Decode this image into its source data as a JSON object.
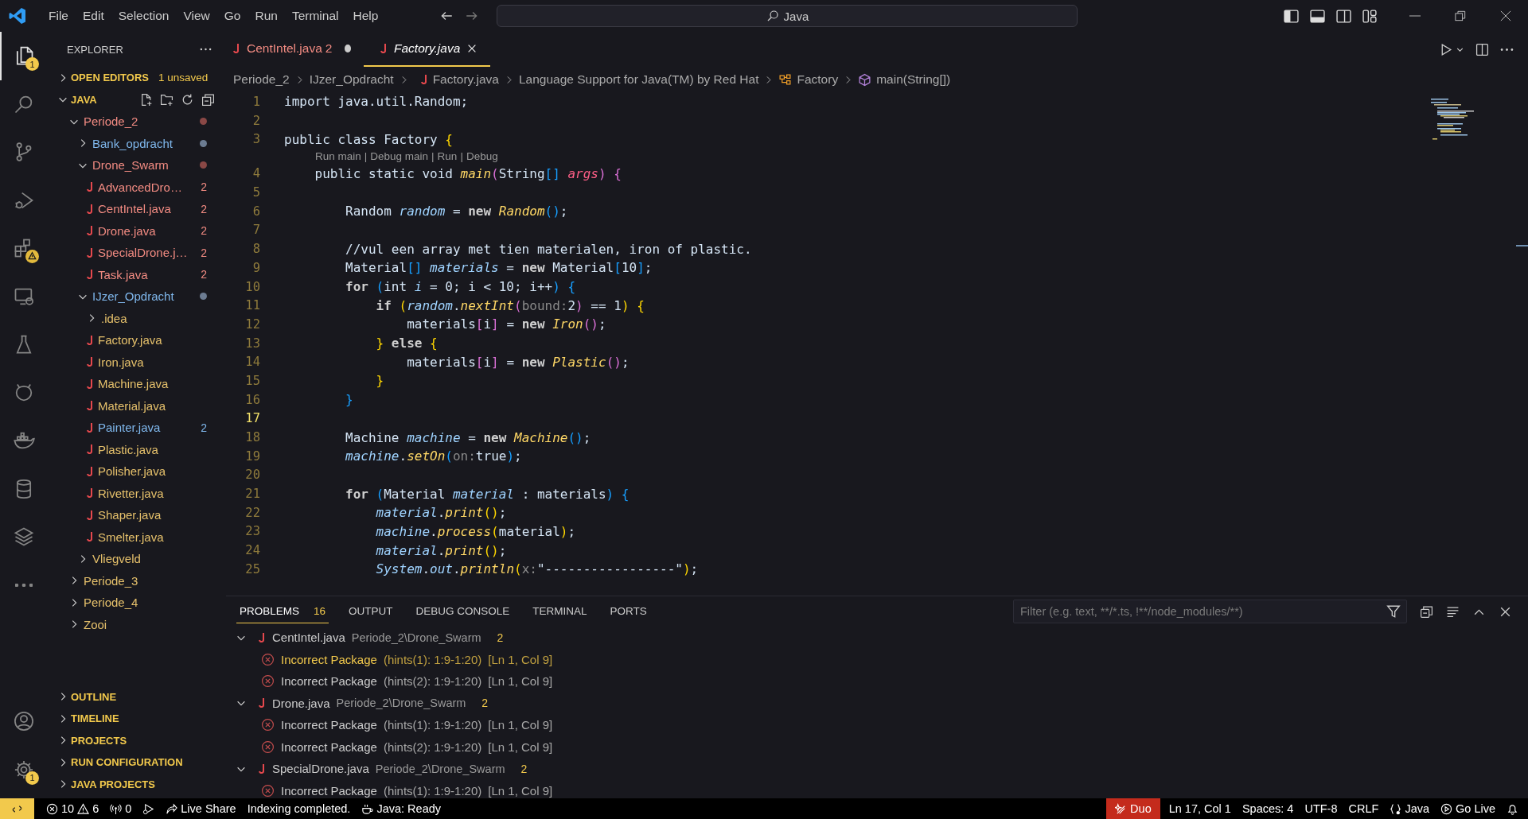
{
  "menu": [
    "File",
    "Edit",
    "Selection",
    "View",
    "Go",
    "Run",
    "Terminal",
    "Help"
  ],
  "command_center": {
    "text": "Java"
  },
  "activity_bar": {
    "top": [
      {
        "kind": "explorer",
        "selected": true,
        "badge": "1",
        "warning": false
      },
      {
        "kind": "search",
        "selected": false,
        "warning": false
      },
      {
        "kind": "scm",
        "selected": false,
        "warning": false
      },
      {
        "kind": "debug",
        "selected": false,
        "warning": false
      },
      {
        "kind": "extensions",
        "selected": false,
        "warning": true
      },
      {
        "kind": "remote",
        "selected": false,
        "warning": false
      },
      {
        "kind": "testing",
        "selected": false,
        "warning": false
      },
      {
        "kind": "alien",
        "selected": false,
        "warning": false
      },
      {
        "kind": "docker",
        "selected": false,
        "warning": false
      },
      {
        "kind": "database",
        "selected": false,
        "warning": false
      },
      {
        "kind": "layers",
        "selected": false,
        "warning": false
      },
      {
        "kind": "more",
        "selected": false,
        "warning": false
      }
    ],
    "bottom": [
      {
        "kind": "account",
        "selected": false,
        "warning": false
      },
      {
        "kind": "settings",
        "selected": false,
        "badge": "1",
        "warning": false
      }
    ]
  },
  "sidebar": {
    "title": "EXPLORER",
    "open_editors": {
      "title": "OPEN EDITORS",
      "expanded": false,
      "note": "1 unsaved"
    },
    "workspace": {
      "title": "JAVA",
      "expanded": true,
      "tree": [
        {
          "name": "Periode_2",
          "kind": "folder",
          "color": "#f28b82",
          "dot": {
            "color": "#8a4846"
          },
          "expanded": true,
          "children": [
            {
              "name": "Bank_opdracht",
              "kind": "folder",
              "color": "#7fb7ec",
              "dot": {
                "color": "#6c7c92"
              },
              "expanded": false
            },
            {
              "name": "Drone_Swarm",
              "kind": "folder",
              "color": "#f28b82",
              "dot": {
                "color": "#8a4846"
              },
              "expanded": true,
              "children": [
                {
                  "name": "AdvancedDro…",
                  "kind": "file",
                  "color": "#f28b82",
                  "badge": "2"
                },
                {
                  "name": "CentIntel.java",
                  "kind": "file",
                  "color": "#f28b82",
                  "badge": "2"
                },
                {
                  "name": "Drone.java",
                  "kind": "file",
                  "color": "#f28b82",
                  "badge": "2"
                },
                {
                  "name": "SpecialDrone.j…",
                  "kind": "file",
                  "color": "#f28b82",
                  "badge": "2"
                },
                {
                  "name": "Task.java",
                  "kind": "file",
                  "color": "#f28b82",
                  "badge": "2"
                }
              ]
            },
            {
              "name": "IJzer_Opdracht",
              "kind": "folder",
              "color": "#7fb7ec",
              "dot": {
                "color": "#6c7c92"
              },
              "expanded": true,
              "children": [
                {
                  "name": ".idea",
                  "kind": "folder",
                  "color": "#e5c06b",
                  "expanded": false
                },
                {
                  "name": "Factory.java",
                  "kind": "file",
                  "color": "#e5c06b"
                },
                {
                  "name": "Iron.java",
                  "kind": "file",
                  "color": "#e5c06b"
                },
                {
                  "name": "Machine.java",
                  "kind": "file",
                  "color": "#e5c06b"
                },
                {
                  "name": "Material.java",
                  "kind": "file",
                  "color": "#e5c06b"
                },
                {
                  "name": "Painter.java",
                  "kind": "file",
                  "color": "#7fb7ec",
                  "badge": "2"
                },
                {
                  "name": "Plastic.java",
                  "kind": "file",
                  "color": "#e5c06b"
                },
                {
                  "name": "Polisher.java",
                  "kind": "file",
                  "color": "#e5c06b"
                },
                {
                  "name": "Rivetter.java",
                  "kind": "file",
                  "color": "#e5c06b"
                },
                {
                  "name": "Shaper.java",
                  "kind": "file",
                  "color": "#e5c06b"
                },
                {
                  "name": "Smelter.java",
                  "kind": "file",
                  "color": "#e5c06b"
                }
              ]
            },
            {
              "name": "Vliegveld",
              "kind": "folder",
              "color": "#e5c06b",
              "expanded": false
            }
          ]
        },
        {
          "name": "Periode_3",
          "kind": "folder",
          "color": "#e5c06b",
          "expanded": false
        },
        {
          "name": "Periode_4",
          "kind": "folder",
          "color": "#e5c06b",
          "expanded": false
        },
        {
          "name": "Zooi",
          "kind": "folder",
          "color": "#e5c06b",
          "expanded": false
        }
      ]
    },
    "sections": [
      {
        "title": "OUTLINE",
        "expanded": false
      },
      {
        "title": "TIMELINE",
        "expanded": false
      },
      {
        "title": "PROJECTS",
        "expanded": false
      },
      {
        "title": "RUN CONFIGURATION",
        "expanded": false
      },
      {
        "title": "JAVA PROJECTS",
        "expanded": false
      }
    ]
  },
  "tabs": [
    {
      "label": "CentIntel.java",
      "badge": "2",
      "color": "#f28b82",
      "selected": false,
      "dirty": true,
      "preview": false
    },
    {
      "label": "Factory.java",
      "color": "#ffffff",
      "selected": true,
      "dirty": false,
      "preview": true
    }
  ],
  "breadcrumbs": [
    {
      "kind": "folder",
      "text": "Periode_2"
    },
    {
      "kind": "folder",
      "text": "IJzer_Opdracht"
    },
    {
      "kind": "file",
      "text": "Factory.java"
    },
    {
      "kind": "text",
      "text": "Language Support for Java(TM) by Red Hat"
    },
    {
      "kind": "class",
      "text": "Factory"
    },
    {
      "kind": "method",
      "text": "main(String[])"
    }
  ],
  "editor": {
    "lines": [
      {
        "kind": "code",
        "number": "1",
        "current": false,
        "tokens": [
          {
            "t": "import java.util.Random;",
            "kind": "plain"
          }
        ]
      },
      {
        "kind": "code",
        "number": "2",
        "current": false
      },
      {
        "kind": "code",
        "number": "3",
        "current": false,
        "tokens": [
          {
            "t": "public class Factory ",
            "kind": "plain"
          },
          {
            "t": "{",
            "kind": "b1"
          }
        ]
      },
      {
        "kind": "codelens",
        "links": [
          "Run main",
          "Debug main",
          "Run",
          "Debug"
        ],
        "separator": "|"
      },
      {
        "kind": "code",
        "number": "4",
        "current": false,
        "tokens": [
          {
            "t": "    public static void ",
            "kind": "plain"
          },
          {
            "t": "main",
            "kind": "fn"
          },
          {
            "t": "(",
            "kind": "b2"
          },
          {
            "t": "String",
            "kind": "plain"
          },
          {
            "t": "[]",
            "kind": "b3"
          },
          {
            "t": " args",
            "kind": "param"
          },
          {
            "t": ")",
            "kind": "b2"
          },
          {
            "t": " {",
            "kind": "b2"
          }
        ]
      },
      {
        "kind": "code",
        "number": "5",
        "current": false
      },
      {
        "kind": "code",
        "number": "6",
        "current": false,
        "tokens": [
          {
            "t": "        Random ",
            "kind": "plain"
          },
          {
            "t": "random",
            "kind": "var"
          },
          {
            "t": " = ",
            "kind": "plain"
          },
          {
            "t": "new",
            "kind": "kw"
          },
          {
            "t": " Random",
            "kind": "fn"
          },
          {
            "t": "()",
            "kind": "b3"
          },
          {
            "t": ";",
            "kind": "plain"
          }
        ]
      },
      {
        "kind": "code",
        "number": "7",
        "current": false
      },
      {
        "kind": "code",
        "number": "8",
        "current": false,
        "tokens": [
          {
            "t": "        //vul een array met tien materialen, iron of plastic.",
            "kind": "plain"
          }
        ]
      },
      {
        "kind": "code",
        "number": "9",
        "current": false,
        "tokens": [
          {
            "t": "        Material",
            "kind": "plain"
          },
          {
            "t": "[]",
            "kind": "b3"
          },
          {
            "t": " materials",
            "kind": "var"
          },
          {
            "t": " = ",
            "kind": "plain"
          },
          {
            "t": "new",
            "kind": "kw"
          },
          {
            "t": " Material",
            "kind": "plain"
          },
          {
            "t": "[",
            "kind": "b3"
          },
          {
            "t": "10",
            "kind": "plain"
          },
          {
            "t": "]",
            "kind": "b3"
          },
          {
            "t": ";",
            "kind": "plain"
          }
        ]
      },
      {
        "kind": "code",
        "number": "10",
        "current": false,
        "tokens": [
          {
            "t": "        for",
            "kind": "kw"
          },
          {
            "t": " (",
            "kind": "b3"
          },
          {
            "t": "int ",
            "kind": "plain"
          },
          {
            "t": "i",
            "kind": "var"
          },
          {
            "t": " = 0; i < 10; i++",
            "kind": "plain"
          },
          {
            "t": ")",
            "kind": "b3"
          },
          {
            "t": " {",
            "kind": "b3"
          }
        ]
      },
      {
        "kind": "code",
        "number": "11",
        "current": false,
        "tokens": [
          {
            "t": "            if",
            "kind": "kw"
          },
          {
            "t": " (",
            "kind": "b1"
          },
          {
            "t": "random",
            "kind": "var"
          },
          {
            "t": ".",
            "kind": "plain"
          },
          {
            "t": "nextInt",
            "kind": "fn"
          },
          {
            "t": "(",
            "kind": "b2"
          },
          {
            "t": "bound:",
            "kind": "hint"
          },
          {
            "t": "2",
            "kind": "plain"
          },
          {
            "t": ")",
            "kind": "b2"
          },
          {
            "t": " == 1",
            "kind": "plain"
          },
          {
            "t": ")",
            "kind": "b1"
          },
          {
            "t": " {",
            "kind": "b1"
          }
        ]
      },
      {
        "kind": "code",
        "number": "12",
        "current": false,
        "tokens": [
          {
            "t": "                materials",
            "kind": "plain"
          },
          {
            "t": "[",
            "kind": "b2"
          },
          {
            "t": "i",
            "kind": "plain"
          },
          {
            "t": "]",
            "kind": "b2"
          },
          {
            "t": " = ",
            "kind": "plain"
          },
          {
            "t": "new",
            "kind": "kw"
          },
          {
            "t": " Iron",
            "kind": "fn"
          },
          {
            "t": "()",
            "kind": "b2"
          },
          {
            "t": ";",
            "kind": "plain"
          }
        ]
      },
      {
        "kind": "code",
        "number": "13",
        "current": false,
        "tokens": [
          {
            "t": "            }",
            "kind": "b1"
          },
          {
            "t": " else",
            "kind": "kw"
          },
          {
            "t": " {",
            "kind": "b1"
          }
        ]
      },
      {
        "kind": "code",
        "number": "14",
        "current": false,
        "tokens": [
          {
            "t": "                materials",
            "kind": "plain"
          },
          {
            "t": "[",
            "kind": "b2"
          },
          {
            "t": "i",
            "kind": "plain"
          },
          {
            "t": "]",
            "kind": "b2"
          },
          {
            "t": " = ",
            "kind": "plain"
          },
          {
            "t": "new",
            "kind": "kw"
          },
          {
            "t": " Plastic",
            "kind": "fn"
          },
          {
            "t": "()",
            "kind": "b2"
          },
          {
            "t": ";",
            "kind": "plain"
          }
        ]
      },
      {
        "kind": "code",
        "number": "15",
        "current": false,
        "tokens": [
          {
            "t": "            }",
            "kind": "b1"
          }
        ]
      },
      {
        "kind": "code",
        "number": "16",
        "current": false,
        "tokens": [
          {
            "t": "        }",
            "kind": "b3"
          }
        ]
      },
      {
        "kind": "code",
        "number": "17",
        "current": true
      },
      {
        "kind": "code",
        "number": "18",
        "current": false,
        "tokens": [
          {
            "t": "        Machine ",
            "kind": "plain"
          },
          {
            "t": "machine",
            "kind": "var"
          },
          {
            "t": " = ",
            "kind": "plain"
          },
          {
            "t": "new",
            "kind": "kw"
          },
          {
            "t": " Machine",
            "kind": "fn"
          },
          {
            "t": "()",
            "kind": "b3"
          },
          {
            "t": ";",
            "kind": "plain"
          }
        ]
      },
      {
        "kind": "code",
        "number": "19",
        "current": false,
        "tokens": [
          {
            "t": "        machine",
            "kind": "var"
          },
          {
            "t": ".",
            "kind": "plain"
          },
          {
            "t": "setOn",
            "kind": "fn"
          },
          {
            "t": "(",
            "kind": "b3"
          },
          {
            "t": "on:",
            "kind": "hint"
          },
          {
            "t": "true",
            "kind": "plain"
          },
          {
            "t": ")",
            "kind": "b3"
          },
          {
            "t": ";",
            "kind": "plain"
          }
        ]
      },
      {
        "kind": "code",
        "number": "20",
        "current": false
      },
      {
        "kind": "code",
        "number": "21",
        "current": false,
        "tokens": [
          {
            "t": "        for",
            "kind": "kw"
          },
          {
            "t": " (",
            "kind": "b3"
          },
          {
            "t": "Material ",
            "kind": "plain"
          },
          {
            "t": "material",
            "kind": "var"
          },
          {
            "t": " : materials",
            "kind": "plain"
          },
          {
            "t": ")",
            "kind": "b3"
          },
          {
            "t": " {",
            "kind": "b3"
          }
        ]
      },
      {
        "kind": "code",
        "number": "22",
        "current": false,
        "tokens": [
          {
            "t": "            material",
            "kind": "var"
          },
          {
            "t": ".",
            "kind": "plain"
          },
          {
            "t": "print",
            "kind": "fn"
          },
          {
            "t": "()",
            "kind": "b1"
          },
          {
            "t": ";",
            "kind": "plain"
          }
        ]
      },
      {
        "kind": "code",
        "number": "23",
        "current": false,
        "tokens": [
          {
            "t": "            machine",
            "kind": "var"
          },
          {
            "t": ".",
            "kind": "plain"
          },
          {
            "t": "process",
            "kind": "fn"
          },
          {
            "t": "(",
            "kind": "b1"
          },
          {
            "t": "material",
            "kind": "plain"
          },
          {
            "t": ")",
            "kind": "b1"
          },
          {
            "t": ";",
            "kind": "plain"
          }
        ]
      },
      {
        "kind": "code",
        "number": "24",
        "current": false,
        "tokens": [
          {
            "t": "            material",
            "kind": "var"
          },
          {
            "t": ".",
            "kind": "plain"
          },
          {
            "t": "print",
            "kind": "fn"
          },
          {
            "t": "()",
            "kind": "b1"
          },
          {
            "t": ";",
            "kind": "plain"
          }
        ]
      },
      {
        "kind": "code",
        "number": "25",
        "current": false,
        "tokens": [
          {
            "t": "            System",
            "kind": "var"
          },
          {
            "t": ".",
            "kind": "plain"
          },
          {
            "t": "out",
            "kind": "var"
          },
          {
            "t": ".",
            "kind": "plain"
          },
          {
            "t": "println",
            "kind": "fn"
          },
          {
            "t": "(",
            "kind": "b1"
          },
          {
            "t": "x:",
            "kind": "hint"
          },
          {
            "t": "\"-----------------\"",
            "kind": "plain"
          },
          {
            "t": ")",
            "kind": "b1"
          },
          {
            "t": ";",
            "kind": "plain"
          }
        ]
      }
    ]
  },
  "panel": {
    "tabs": [
      {
        "label": "PROBLEMS",
        "count": "16",
        "selected": true
      },
      {
        "label": "OUTPUT",
        "selected": false
      },
      {
        "label": "DEBUG CONSOLE",
        "selected": false
      },
      {
        "label": "TERMINAL",
        "selected": false
      },
      {
        "label": "PORTS",
        "selected": false
      }
    ],
    "filter": {
      "placeholder": "Filter (e.g. text, **/*.ts, !**/node_modules/**)"
    },
    "problems": [
      {
        "file": "CentIntel.java",
        "path": "Periode_2\\Drone_Swarm",
        "count": "2",
        "expanded": true,
        "items": [
          {
            "message": "Incorrect Package",
            "code": "(hints(1): 1:9-1:20)",
            "location": "[Ln 1, Col 9]",
            "selected": true
          },
          {
            "message": "Incorrect Package",
            "code": "(hints(2): 1:9-1:20)",
            "location": "[Ln 1, Col 9]",
            "selected": false
          }
        ]
      },
      {
        "file": "Drone.java",
        "path": "Periode_2\\Drone_Swarm",
        "count": "2",
        "expanded": true,
        "items": [
          {
            "message": "Incorrect Package",
            "code": "(hints(1): 1:9-1:20)",
            "location": "[Ln 1, Col 9]",
            "selected": false
          },
          {
            "message": "Incorrect Package",
            "code": "(hints(2): 1:9-1:20)",
            "location": "[Ln 1, Col 9]",
            "selected": false
          }
        ]
      },
      {
        "file": "SpecialDrone.java",
        "path": "Periode_2\\Drone_Swarm",
        "count": "2",
        "expanded": true,
        "items": [
          {
            "message": "Incorrect Package",
            "code": "(hints(1): 1:9-1:20)",
            "location": "[Ln 1, Col 9]",
            "selected": false
          }
        ]
      }
    ]
  },
  "status_bar": {
    "left": [
      {
        "kind": "remote"
      },
      {
        "kind": "problems",
        "errors": "10",
        "warnings": "6"
      },
      {
        "kind": "ports",
        "text": "0"
      },
      {
        "kind": "debug"
      },
      {
        "kind": "live_share",
        "text": "Live Share"
      },
      {
        "kind": "text",
        "text": "Indexing completed."
      },
      {
        "kind": "java",
        "text": "Java: Ready"
      }
    ],
    "right": [
      {
        "kind": "duo",
        "text": "Duo"
      },
      {
        "kind": "text",
        "text": "Ln 17, Col 1"
      },
      {
        "kind": "text",
        "text": "Spaces: 4"
      },
      {
        "kind": "text",
        "text": "UTF-8"
      },
      {
        "kind": "text",
        "text": "CRLF"
      },
      {
        "kind": "language",
        "text": "Java"
      },
      {
        "kind": "golive",
        "text": "Go Live"
      },
      {
        "kind": "bell"
      }
    ]
  }
}
